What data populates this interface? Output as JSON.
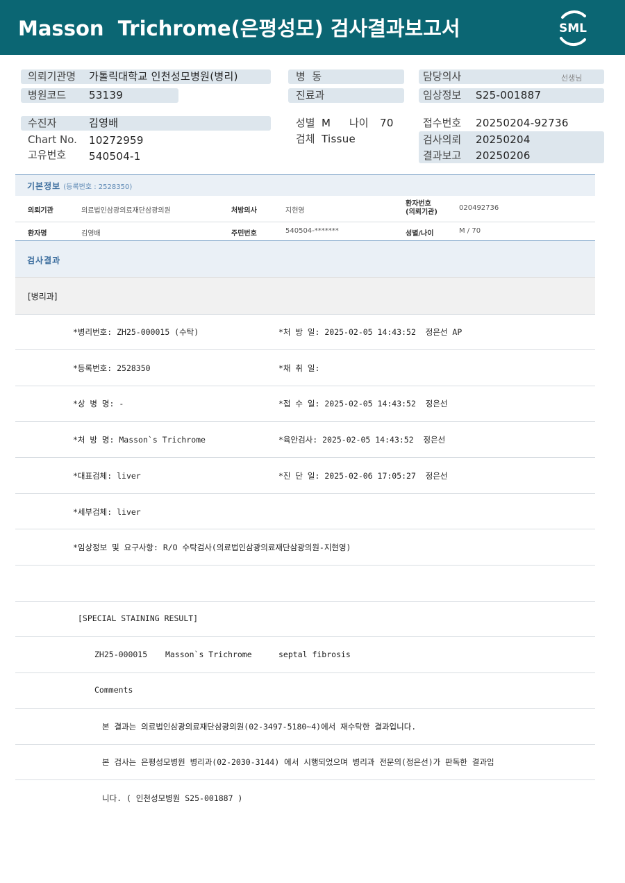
{
  "header": {
    "title": "Masson  Trichrome(은평성모) 검사결과보고서",
    "logo_text": "SML",
    "bg_color": "#0b6673"
  },
  "patient": {
    "inst_label": "의뢰기관명",
    "inst_value": "가톨릭대학교 인천성모병원(병리)",
    "hosp_code_label": "병원코드",
    "hosp_code_value": "53139",
    "ward_label": "병  동",
    "dept_label": "진료과",
    "doctor_label": "담당의사",
    "doctor_suffix": "선생님",
    "clinical_label": "임상정보",
    "clinical_value": "S25-001887",
    "name_label": "수진자",
    "name_value": "김영배",
    "chart_label": "Chart No.",
    "chart_value": "10272959",
    "uid_label": "고유번호",
    "uid_value": "540504-1",
    "sex_label": "성별",
    "sex_value": "M",
    "age_label": "나이",
    "age_value": "70",
    "specimen_label": "검체",
    "specimen_value": "Tissue",
    "receipt_label": "접수번호",
    "receipt_value": "20250204-92736",
    "request_label": "검사의뢰",
    "request_value": "20250204",
    "report_label": "결과보고",
    "report_value": "20250206"
  },
  "basic_info": {
    "title": "기본정보",
    "reg_no": "(등록번호 : 2528350)",
    "labels": {
      "inst": "의뢰기관",
      "prescriber": "처방의사",
      "pid": "환자번호\n(의뢰기관)",
      "name": "환자명",
      "rrn": "주민번호",
      "sexage": "성별/나이"
    },
    "values": {
      "inst": "의료법인삼광의료재단삼광의원",
      "prescriber": "지현영",
      "pid": "020492736",
      "name": "김영배",
      "rrn": "540504-*******",
      "sexage": "M / 70"
    }
  },
  "result": {
    "title": "검사결과",
    "dept": "[병리과]",
    "rows": [
      {
        "left": "*병리번호: ZH25-000015 (수탁)",
        "right": "*처 방 일: 2025-02-05 14:43:52  정은선 AP"
      },
      {
        "left": "*등록번호: 2528350",
        "right": "*채 취 일:"
      },
      {
        "left": "*상 병 명: -",
        "right": "*접 수 일: 2025-02-05 14:43:52  정은선"
      },
      {
        "left": "*처 방 명: Masson`s Trichrome",
        "right": "*육안검사: 2025-02-05 14:43:52  정은선"
      },
      {
        "left": "*대표검체: liver",
        "right": "*진 단 일: 2025-02-06 17:05:27  정은선"
      },
      {
        "left": "*세부검체: liver",
        "right": ""
      },
      {
        "left": "*임상정보 및 요구사항: R/O 수탁검사(의료법인삼광의료재단삼광의원-지현영)",
        "right": ""
      }
    ],
    "special_heading": "[SPECIAL STAINING RESULT]",
    "special_id": "ZH25-000015",
    "special_stain": "Masson`s Trichrome",
    "special_result": "septal fibrosis",
    "comments_label": "Comments",
    "comment1": "본 결과는 의료법인삼광의료재단삼광의원(02-3497-5180~4)에서 재수탁한 결과입니다.",
    "comment2": "본 검사는 은평성모병원 병리과(02-2030-3144) 에서 시행되었으며 병리과 전문의(정은선)가 판독한 결과입",
    "comment3": "니다. ( 인천성모병원 S25-001887 )"
  }
}
